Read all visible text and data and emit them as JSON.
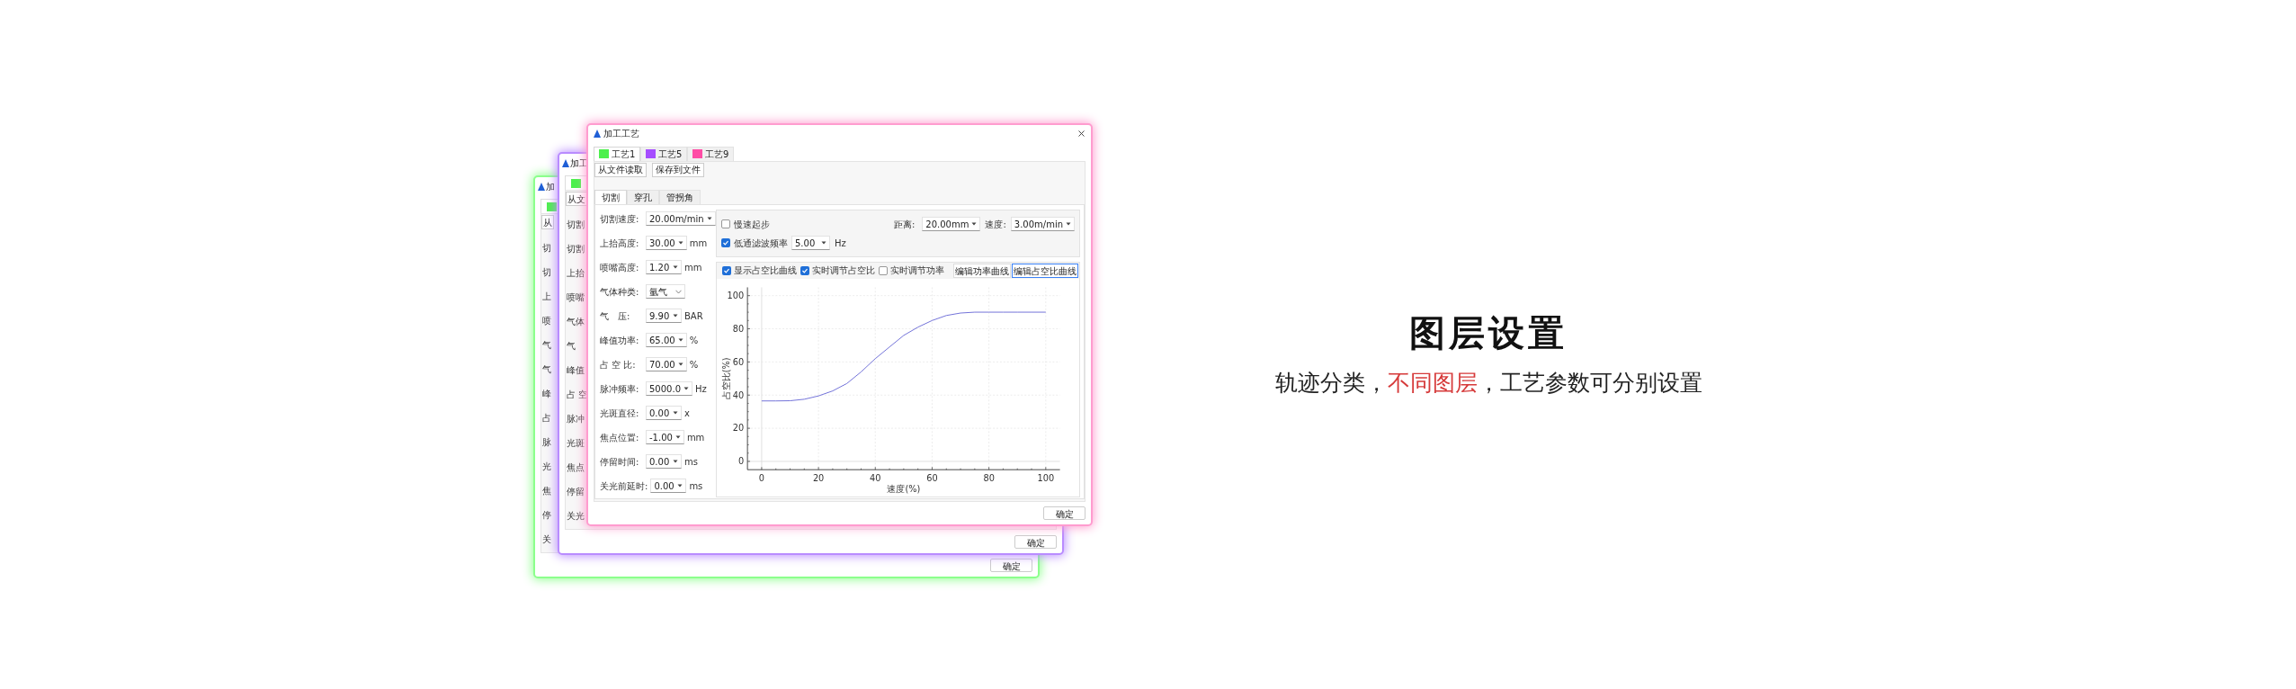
{
  "back_windows": [
    {
      "color": "#8cff8c",
      "title": "加",
      "tab": {
        "color": "#4cf04c"
      },
      "load_button": "从",
      "labels": [
        "切",
        "切",
        "上",
        "喷",
        "气",
        "气",
        "峰",
        "占",
        "脉",
        "光",
        "焦",
        "停",
        "关"
      ],
      "confirm_button": "确定"
    },
    {
      "color": "#b98cff",
      "title": "加工",
      "tab": {
        "color": "#4cf04c"
      },
      "load_button": "从文",
      "labels": [
        "切割",
        "切割",
        "上抬",
        "喷嘴",
        "气体",
        "气",
        "峰值",
        "占 空",
        "脉冲",
        "光斑",
        "焦点",
        "停留",
        "关光"
      ],
      "confirm_button": "确定"
    }
  ],
  "window": {
    "color": "#ff9ccf",
    "title": "加工工艺",
    "process_tabs": [
      {
        "label": "工艺1",
        "color": "#4cf04c",
        "selected": true
      },
      {
        "label": "工艺5",
        "color": "#a64dff",
        "selected": false
      },
      {
        "label": "工艺9",
        "color": "#ff4da6",
        "selected": false
      }
    ],
    "file_buttons": [
      "从文件读取",
      "保存到文件"
    ],
    "section_tabs": [
      {
        "label": "切割",
        "selected": true
      },
      {
        "label": "穿孔",
        "selected": false
      },
      {
        "label": "管拐角",
        "selected": false
      }
    ],
    "form": [
      {
        "kind": "combo",
        "label": "切割速度:",
        "value": "20.00m/min"
      },
      {
        "kind": "spin",
        "label": "上抬高度:",
        "value": "30.00",
        "unit": "mm"
      },
      {
        "kind": "spin",
        "label": "喷嘴高度:",
        "value": "1.20",
        "unit": "mm"
      },
      {
        "kind": "select",
        "label": "气体种类:",
        "value": "氩气"
      },
      {
        "kind": "spin",
        "label": "气　压:",
        "value": "9.90",
        "unit": "BAR"
      },
      {
        "kind": "spin",
        "label": "峰值功率:",
        "value": "65.00",
        "unit": "%"
      },
      {
        "kind": "spin",
        "label": "占 空 比:",
        "value": "70.00",
        "unit": "%"
      },
      {
        "kind": "spin",
        "label": "脉冲频率:",
        "value": "5000.0",
        "unit": "Hz"
      },
      {
        "kind": "spin",
        "label": "光斑直径:",
        "value": "0.00",
        "unit": "x"
      },
      {
        "kind": "spin",
        "label": "焦点位置:",
        "value": "-1.00",
        "unit": "mm"
      },
      {
        "kind": "spin",
        "label": "停留时间:",
        "value": "0.00",
        "unit": "ms"
      },
      {
        "kind": "spin",
        "label": "关光前延时:",
        "value": "0.00",
        "unit": "ms"
      }
    ],
    "slow_start": {
      "label": "慢速起步",
      "checked": false
    },
    "distance": {
      "label": "距离:",
      "value": "20.00mm"
    },
    "speed": {
      "label": "速度:",
      "value": "3.00m/min"
    },
    "low_pass": {
      "label": "低通滤波频率",
      "checked": true,
      "value": "5.00",
      "unit": "Hz"
    },
    "chart_options": [
      {
        "label": "显示占空比曲线",
        "checked": true
      },
      {
        "label": "实时调节占空比",
        "checked": true
      },
      {
        "label": "实时调节功率",
        "checked": false
      }
    ],
    "chart_buttons": [
      {
        "label": "编辑功率曲线",
        "focused": false
      },
      {
        "label": "编辑占空比曲线",
        "focused": true
      }
    ],
    "chart_data": {
      "type": "line",
      "grid": true,
      "xlabel": "速度(%)",
      "ylabel": "占空比(%)",
      "x": [
        0,
        5,
        10,
        15,
        20,
        25,
        30,
        35,
        40,
        45,
        50,
        55,
        60,
        65,
        70,
        75,
        80,
        85,
        90,
        95,
        100
      ],
      "series": [
        {
          "color": "#7070d8",
          "values": [
            36.5,
            36.5,
            36.6,
            37.5,
            39.5,
            42.5,
            47,
            54,
            62,
            69,
            76,
            81,
            85,
            88,
            89.5,
            90,
            90,
            90,
            90,
            90,
            90
          ]
        }
      ],
      "xlim": [
        -5,
        105
      ],
      "ylim": [
        -5,
        105
      ],
      "xticks": [
        0,
        20,
        40,
        60,
        80,
        100
      ],
      "yticks": [
        0,
        20,
        40,
        60,
        80,
        100
      ]
    },
    "confirm_button": "确定"
  },
  "promo": {
    "title": "图层设置",
    "subtitle": [
      {
        "text": "轨迹分类，",
        "highlight": false
      },
      {
        "text": "不同图层",
        "highlight": true
      },
      {
        "text": "，工艺参数可分别设置",
        "highlight": false
      }
    ]
  }
}
